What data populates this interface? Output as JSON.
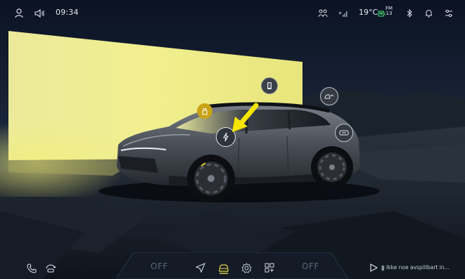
{
  "status_bar": {
    "time": "09:34",
    "temperature": "19°C",
    "fm_top": "FM",
    "fm_bottom": "13",
    "icons": [
      "profile-icon",
      "volume-muted-icon",
      "people-icon",
      "no-signal-icon",
      "fuel-icon",
      "fm-radio-icon",
      "bluetooth-icon",
      "bell-icon",
      "settings-sliders-icon"
    ]
  },
  "vehicle_hotspots": [
    {
      "name": "phone-key-hotspot",
      "icon": "phone-icon"
    },
    {
      "name": "lock-hotspot",
      "icon": "lock-icon",
      "color": "#c9a316"
    },
    {
      "name": "charging-hotspot",
      "icon": "charge-bolt-icon"
    },
    {
      "name": "trunk-hotspot",
      "icon": "trunk-icon"
    },
    {
      "name": "charge-port-hotspot",
      "icon": "charge-port-icon"
    }
  ],
  "dock": {
    "left_off": "OFF",
    "right_off": "OFF",
    "media_text": "Ikke noe avspillbart in...",
    "icons": [
      "phone-icon",
      "car-sync-icon",
      "navigation-icon",
      "car-icon",
      "settings-icon",
      "apps-icon",
      "play-icon",
      "bluetooth-icon"
    ],
    "active_color": "#e7d94a"
  },
  "colors": {
    "accent_yellow": "#f0ec5a",
    "arrow_yellow": "#f5e600"
  }
}
